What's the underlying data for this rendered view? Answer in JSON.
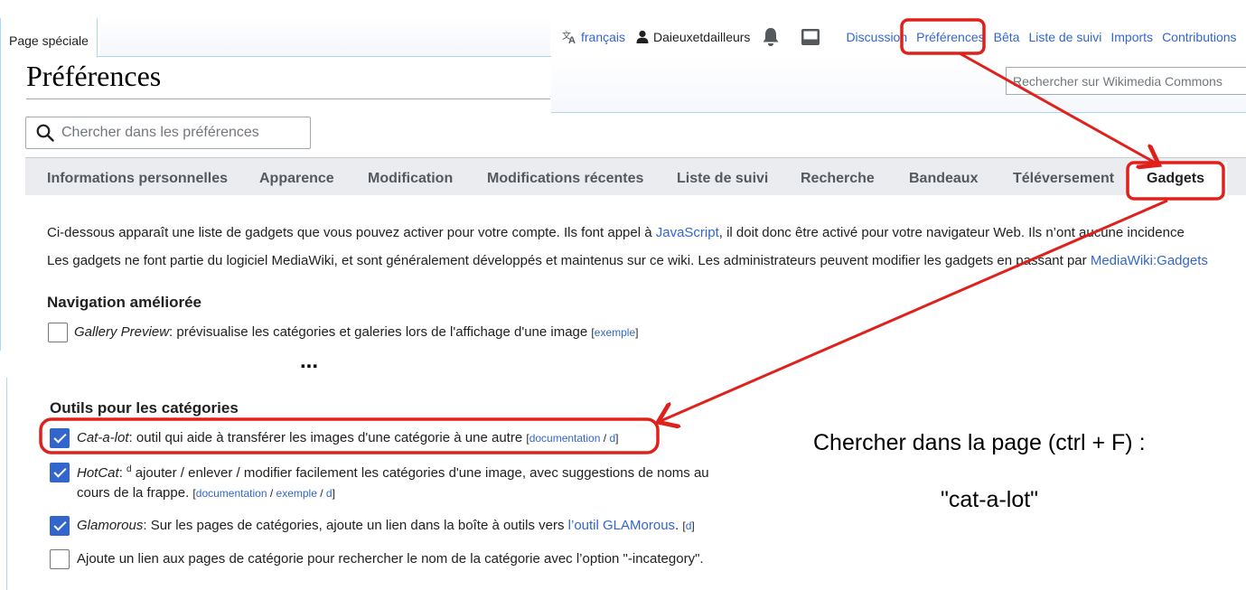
{
  "page_tab": "Page spéciale",
  "title": "Préférences",
  "personal_bar": {
    "language": "français",
    "user": "Daieuxetdailleurs",
    "links": [
      "Discussion",
      "Préférences",
      "Bêta",
      "Liste de suivi",
      "Imports",
      "Contributions"
    ]
  },
  "site_search_placeholder": "Rechercher sur Wikimedia Commons",
  "pref_search_placeholder": "Chercher dans les préférences",
  "tabs": [
    "Informations personnelles",
    "Apparence",
    "Modification",
    "Modifications récentes",
    "Liste de suivi",
    "Recherche",
    "Bandeaux",
    "Téléversement",
    "Gadgets"
  ],
  "active_tab": "Gadgets",
  "intro": {
    "line1_a": "Ci-dessous apparaît une liste de gadgets que vous pouvez activer pour votre compte. Ils font appel à ",
    "line1_link": "JavaScript",
    "line1_b": ", il doit donc être activé pour votre navigateur Web. Ils n’ont aucune incidence",
    "line2_a": "Les gadgets ne font partie du logiciel MediaWiki, et sont généralement développés et maintenus sur ce wiki. Les administrateurs peuvent modifier les gadgets en passant par ",
    "line2_link": "MediaWiki:Gadgets"
  },
  "section_nav": "Navigation améliorée",
  "gallery_preview": {
    "name": "Gallery Preview",
    "desc": ": prévisualise les catégories et galeries lors de l'affichage d'une image ",
    "link": "exemple",
    "checked": false
  },
  "ellipsis": "...",
  "section_cat": "Outils pour les catégories",
  "catalot": {
    "name": "Cat-a-lot",
    "desc": ": outil qui aide à transférer les images d'une catégorie à une autre ",
    "link1": "documentation",
    "sep": "/",
    "link2": "d",
    "checked": true
  },
  "hotcat": {
    "name": "HotCat",
    "sup": "d",
    "desc1": " ajouter / enlever / modifier facilement les catégories d'une image, avec suggestions de noms au",
    "desc2": "cours de la frappe. ",
    "link1": "documentation",
    "link2": "exemple",
    "link3": "d",
    "checked": true
  },
  "glamorous": {
    "name": "Glamorous",
    "desc": ": Sur les pages de catégories, ajoute un lien dans la boîte à outils vers ",
    "link": "l’outil GLAMorous",
    "after": ".",
    "d": "d",
    "checked": true
  },
  "incategory": {
    "desc": "Ajoute un lien aux pages de catégorie pour rechercher le nom de la catégorie avec l’option \"-incategory\".",
    "checked": false
  },
  "annotation": {
    "line1": "Chercher dans la page (ctrl + F) :",
    "line2": "\"cat-a-lot\"",
    "color": "#e0201b"
  }
}
